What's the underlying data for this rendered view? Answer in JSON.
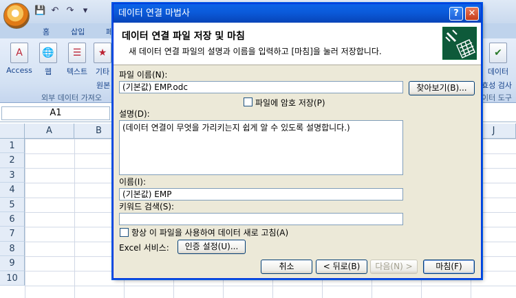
{
  "excel": {
    "tabs": [
      "홈",
      "삽입",
      "페"
    ],
    "ribbon_buttons": [
      {
        "label": "Access"
      },
      {
        "label": "웹"
      },
      {
        "label": "텍스트"
      },
      {
        "label": "기타"
      },
      {
        "label": "원본"
      }
    ],
    "ribbon_right_button": "데이터",
    "ribbon_right_button_2": "효성 검사",
    "group_label_left": "외부 데이터 가져오",
    "group_label_right": "이터 도구",
    "name_box": "A1",
    "columns": [
      "A",
      "B",
      "J"
    ],
    "rows": [
      "1",
      "2",
      "3",
      "4",
      "5",
      "6",
      "7",
      "8",
      "9",
      "10"
    ]
  },
  "dialog": {
    "title": "데이터 연결 마법사",
    "header_title": "데이터 연결 파일 저장 및 마침",
    "header_subtitle": "새 데이터 연결 파일의 설명과 이름을 입력하고 [마침]을 눌러 저장합니다.",
    "file_name_label": "파일 이름(N):",
    "file_name_value": "(기본값) EMP.odc",
    "browse_button": "찾아보기(B)...",
    "password_checkbox_label": "파일에 암호 저장(P)",
    "description_label": "설명(D):",
    "description_value": "(데이터 연결이 무엇을 가리키는지 쉽게 알 수 있도록 설명합니다.)",
    "name_label": "이름(I):",
    "name_value": "(기본값) EMP",
    "keyword_label": "키워드 검색(S):",
    "keyword_value": "",
    "refresh_checkbox_label": "항상 이 파일을 사용하여 데이터 새로 고침(A)",
    "excel_services_label": "Excel 서비스:",
    "auth_button": "인증 설정(U)...",
    "cancel_button": "취소",
    "back_button": "< 뒤로(B)",
    "next_button": "다음(N) >",
    "finish_button": "마침(F)"
  }
}
